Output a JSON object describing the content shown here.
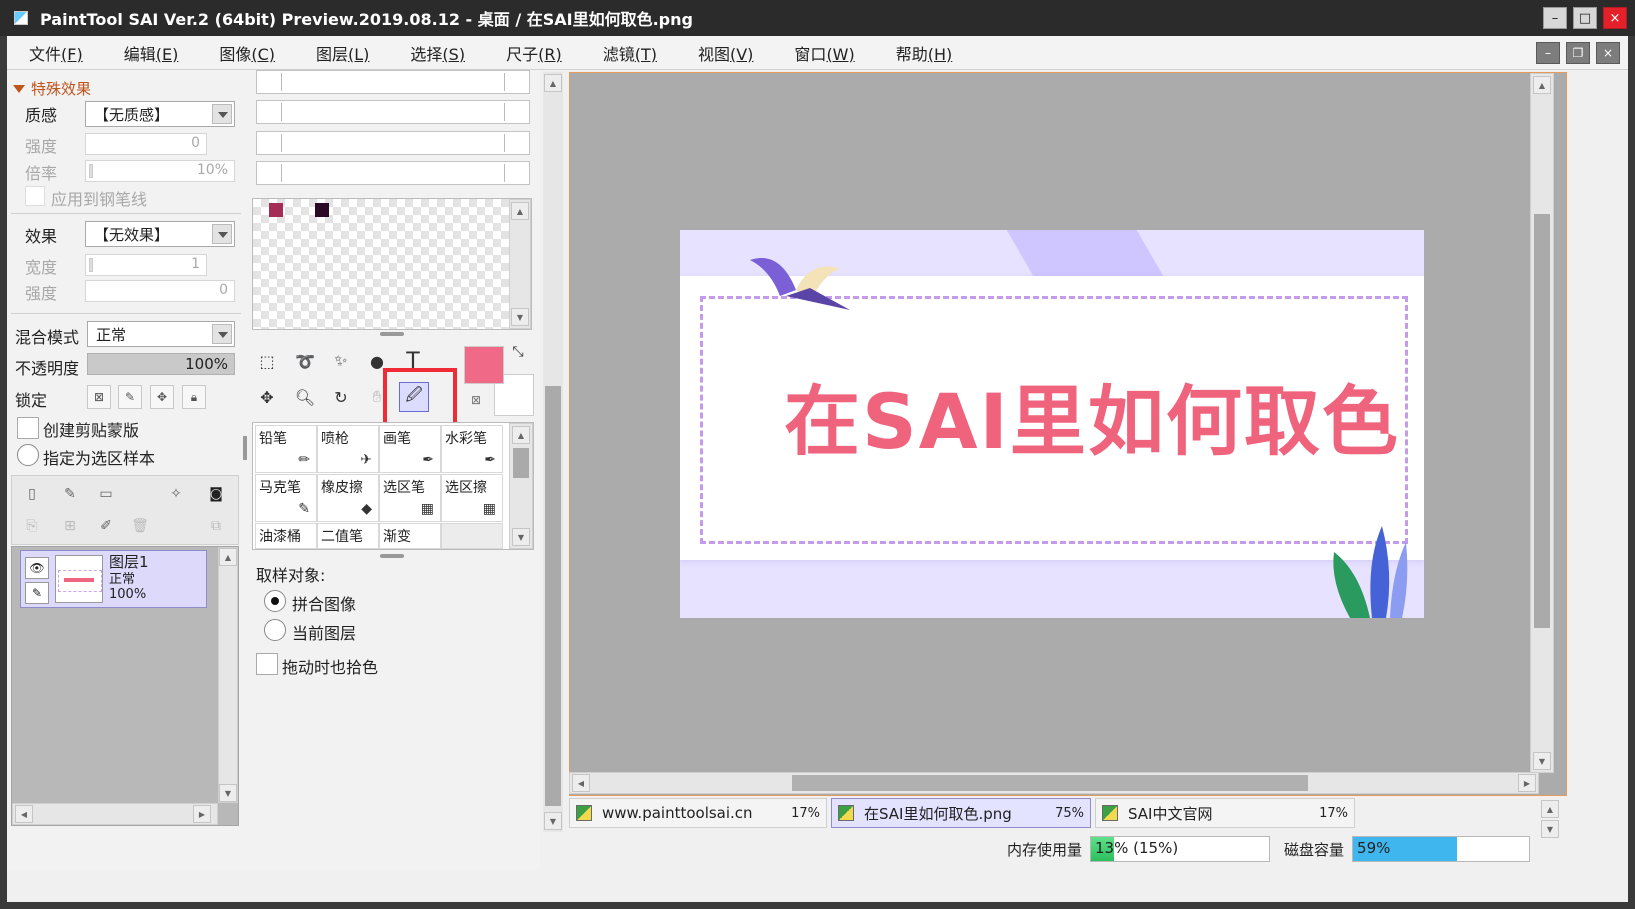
{
  "window": {
    "title": "PaintTool SAI Ver.2 (64bit) Preview.2019.08.12 - 桌面 / 在SAI里如何取色.png",
    "minimize": "–",
    "maximize": "□",
    "close": "×"
  },
  "menu": [
    {
      "label": "文件",
      "key": "(F)"
    },
    {
      "label": "编辑",
      "key": "(E)"
    },
    {
      "label": "图像",
      "key": "(C)"
    },
    {
      "label": "图层",
      "key": "(L)"
    },
    {
      "label": "选择",
      "key": "(S)"
    },
    {
      "label": "尺子",
      "key": "(R)"
    },
    {
      "label": "滤镜",
      "key": "(T)"
    },
    {
      "label": "视图",
      "key": "(V)"
    },
    {
      "label": "窗口",
      "key": "(W)"
    },
    {
      "label": "帮助",
      "key": "(H)"
    }
  ],
  "effects": {
    "section_title": "特殊效果",
    "texture_label": "质感",
    "texture_value": "【无质感】",
    "strength_label": "强度",
    "strength_value": "0",
    "scale_label": "倍率",
    "scale_value": "10%",
    "apply_to_pen_label": "应用到钢笔线",
    "effect_label": "效果",
    "effect_value": "【无效果】",
    "width_label": "宽度",
    "width_value": "1",
    "strength2_label": "强度",
    "strength2_value": "0"
  },
  "layer_props": {
    "blend_label": "混合模式",
    "blend_value": "正常",
    "opacity_label": "不透明度",
    "opacity_value": "100%",
    "lock_label": "锁定",
    "clip_label": "创建剪贴蒙版",
    "sample_source_label": "指定为选区样本"
  },
  "layers": [
    {
      "name": "图层1",
      "mode": "正常",
      "opacity": "100%"
    }
  ],
  "swatches": [
    "#a42d58",
    "#2a0a25"
  ],
  "colors": {
    "main": "#f06a87",
    "sub": "#ffffff",
    "accent": "#ef2b36"
  },
  "brushes": [
    {
      "label": "铅笔",
      "icon": "pencil-icon",
      "glyph": "✏"
    },
    {
      "label": "喷枪",
      "icon": "airbrush-icon",
      "glyph": "✈"
    },
    {
      "label": "画笔",
      "icon": "brush-icon",
      "glyph": "✒"
    },
    {
      "label": "水彩笔",
      "icon": "watercolor-icon",
      "glyph": "✒"
    },
    {
      "label": "马克笔",
      "icon": "marker-icon",
      "glyph": "✎"
    },
    {
      "label": "橡皮擦",
      "icon": "eraser-icon",
      "glyph": "◆"
    },
    {
      "label": "选区笔",
      "icon": "select-pen-icon",
      "glyph": "▦"
    },
    {
      "label": "选区擦",
      "icon": "select-eraser-icon",
      "glyph": "▦"
    },
    {
      "label": "油漆桶",
      "icon": "",
      "glyph": ""
    },
    {
      "label": "二值笔",
      "icon": "",
      "glyph": ""
    },
    {
      "label": "渐变",
      "icon": "",
      "glyph": ""
    }
  ],
  "eyedropper": {
    "sample_target_label": "取样对象:",
    "opt_merged": "拼合图像",
    "opt_current": "当前图层",
    "drag_pick_label": "拖动时也拾色"
  },
  "artwork": {
    "title": "在SAI里如何取色"
  },
  "tabs": [
    {
      "name": "www.painttoolsai.cn",
      "zoom": "17%",
      "active": false
    },
    {
      "name": "在SAI里如何取色.png",
      "zoom": "75%",
      "active": true
    },
    {
      "name": "SAI中文官网",
      "zoom": "17%",
      "active": false
    }
  ],
  "status": {
    "memory_label": "内存使用量",
    "memory_value": "13% (15%)",
    "memory_fraction": 0.13,
    "disk_label": "磁盘容量",
    "disk_value": "59%",
    "disk_fraction": 0.59
  }
}
